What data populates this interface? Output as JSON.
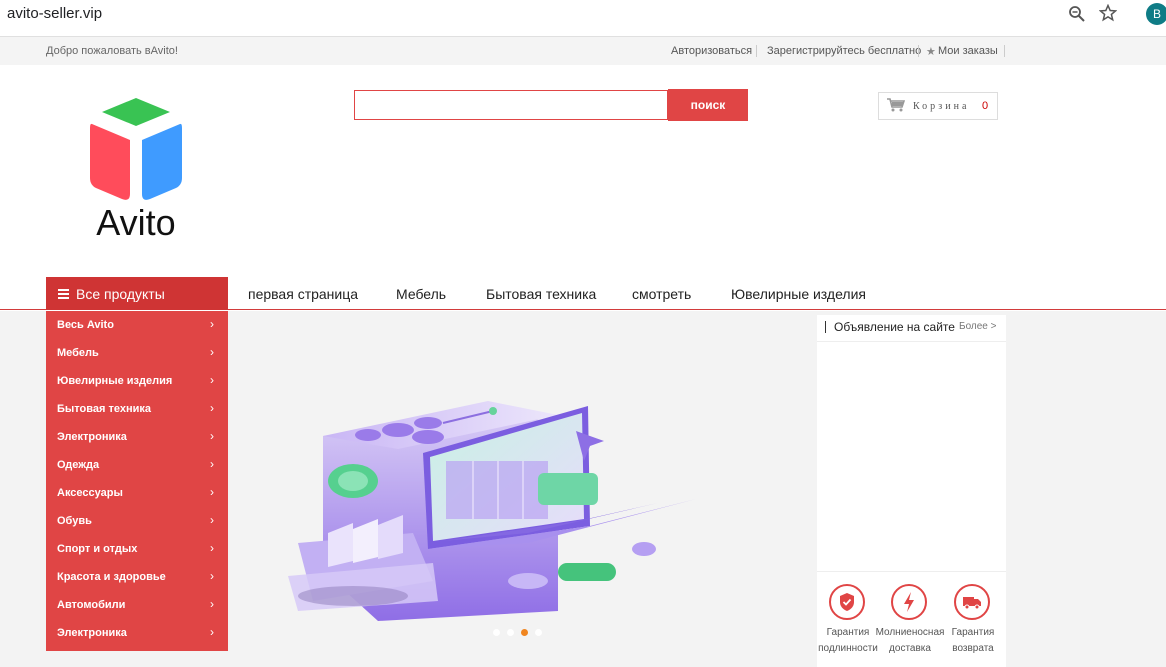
{
  "browser": {
    "url": "avito-seller.vip",
    "profile_initial": "B"
  },
  "topbar": {
    "welcome": "Добро пожаловать вAvito!",
    "login": "Авторизоваться",
    "register": "Зарегистрируйтесь бесплатно",
    "orders": "Мои заказы",
    "orders_star": "★"
  },
  "header": {
    "logo_text": "Avito",
    "search_placeholder": "",
    "search_button": "поиск",
    "cart_label": "Корзина",
    "cart_count": "0"
  },
  "nav": {
    "all_products": "Все продукты",
    "links": [
      "первая страница",
      "Мебель",
      "Бытовая техника",
      "смотреть",
      "Ювелирные изделия"
    ]
  },
  "sidebar": {
    "categories": [
      "Весь Avito",
      "Мебель",
      "Ювелирные изделия",
      "Бытовая техника",
      "Электроника",
      "Одежда",
      "Аксессуары",
      "Обувь",
      "Спорт и отдых",
      "Красота и здоровье",
      "Автомобили",
      "Электроника"
    ],
    "chevron": "›"
  },
  "banner": {
    "slides": 4,
    "active_slide": 3
  },
  "ads": {
    "title": "Объявление на сайте",
    "more": "Более >",
    "features": [
      {
        "icon": "shield-check-icon",
        "line1": "Гарантия",
        "line2": "подлинности"
      },
      {
        "icon": "lightning-icon",
        "line1": "Молниеносная",
        "line2": "доставка"
      },
      {
        "icon": "truck-icon",
        "line1": "Гарантия",
        "line2": "возврата"
      }
    ]
  },
  "colors": {
    "accent": "#e04545",
    "nav_red": "#cf3434",
    "active_dot": "#f0851f"
  }
}
